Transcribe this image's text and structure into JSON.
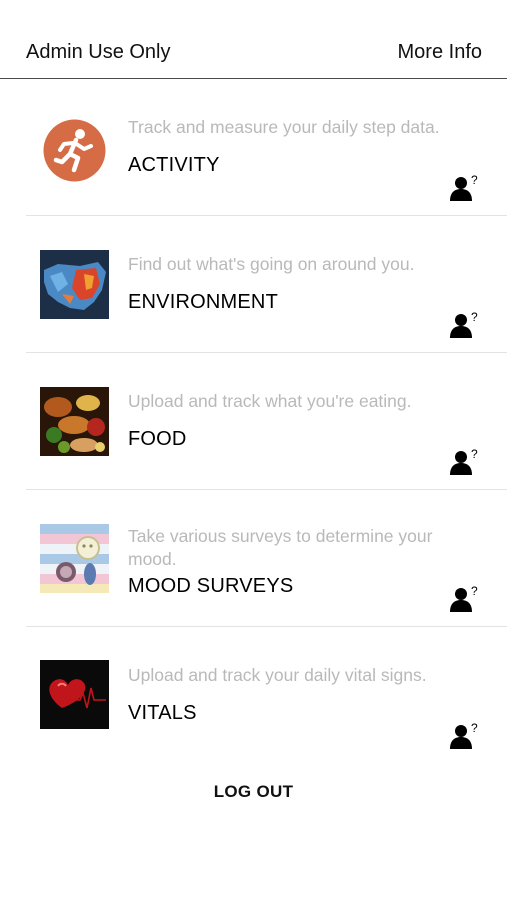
{
  "header": {
    "left_label": "Admin Use Only",
    "right_label": "More Info"
  },
  "modules": [
    {
      "key": "activity",
      "title": "ACTIVITY",
      "description": "Track and measure your daily step data.",
      "icon": "running-person-icon",
      "color": "#d56c45"
    },
    {
      "key": "environment",
      "title": "ENVIRONMENT",
      "description": "Find out what's going on around you.",
      "icon": "us-map-image",
      "color": "#3d6fa0"
    },
    {
      "key": "food",
      "title": "FOOD",
      "description": "Upload and track what you're eating.",
      "icon": "food-image",
      "color": "#8a4a1c"
    },
    {
      "key": "mood",
      "title": "MOOD SURVEYS",
      "description": "Take various surveys to determine your mood.",
      "icon": "mood-image",
      "color": "#a9c9e6"
    },
    {
      "key": "vitals",
      "title": "VITALS",
      "description": "Upload and track your daily vital signs.",
      "icon": "heart-ecg-image",
      "color": "#c0151b"
    }
  ],
  "help_icon": "person-question-icon",
  "logout_label": "LOG OUT"
}
